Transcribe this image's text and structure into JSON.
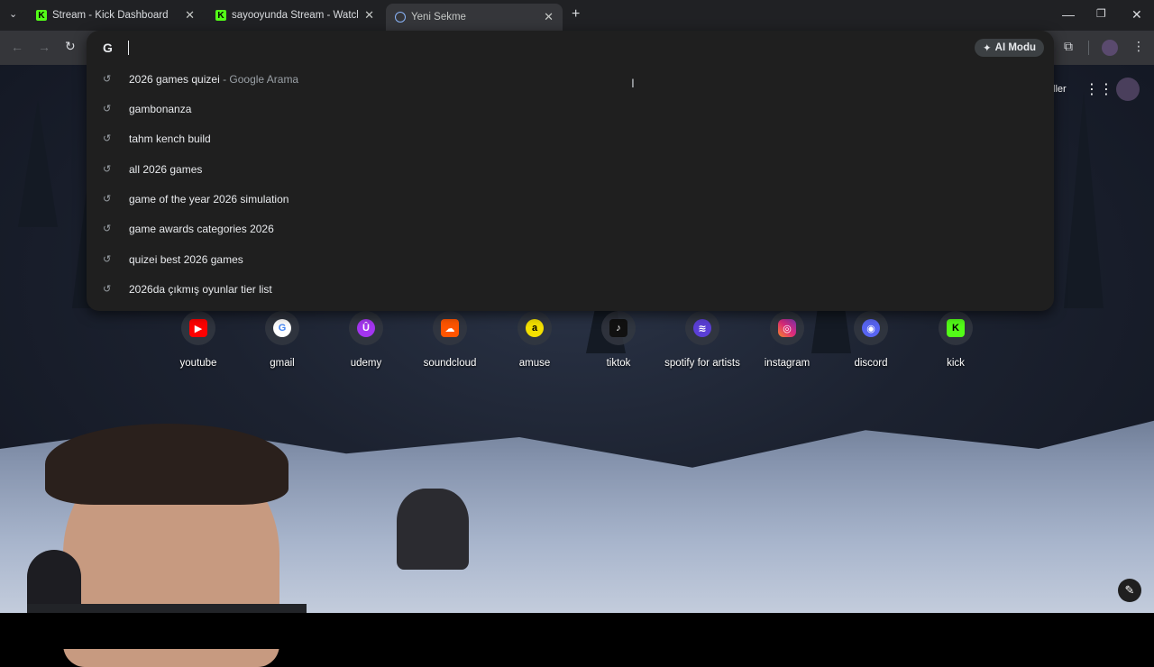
{
  "tabs": [
    {
      "title": "Stream - Kick Dashboard",
      "favicon": "kick-icon"
    },
    {
      "title": "sayooyunda Stream - Watch Liv",
      "favicon": "kick-icon"
    },
    {
      "title": "Yeni Sekme",
      "favicon": "globe-icon"
    }
  ],
  "omnibox": {
    "ai_mode_label": "AI Modu"
  },
  "suggestions": [
    {
      "text": "2026 games quizei",
      "sub": " -  Google Arama"
    },
    {
      "text": "gambonanza",
      "sub": ""
    },
    {
      "text": "tahm kench build",
      "sub": ""
    },
    {
      "text": "all 2026 games",
      "sub": ""
    },
    {
      "text": "game of the year 2026 simulation",
      "sub": ""
    },
    {
      "text": "game awards categories 2026",
      "sub": ""
    },
    {
      "text": "quizei best 2026 games",
      "sub": ""
    },
    {
      "text": "2026da çıkmış oyunlar tier list",
      "sub": ""
    }
  ],
  "top_right": {
    "label_fragment": "ller"
  },
  "shortcuts": [
    {
      "label": "youtube",
      "color": "#ff0000",
      "glyph": "▶"
    },
    {
      "label": "gmail",
      "color": "#4285f4",
      "glyph": "G"
    },
    {
      "label": "udemy",
      "color": "#a435f0",
      "glyph": "Û"
    },
    {
      "label": "soundcloud",
      "color": "#ff5500",
      "glyph": "☁"
    },
    {
      "label": "amuse",
      "color": "#f5e100",
      "glyph": "a"
    },
    {
      "label": "tiktok",
      "color": "#111111",
      "glyph": "♪"
    },
    {
      "label": "spotify for artists",
      "color": "#5b3fd6",
      "glyph": "≋"
    },
    {
      "label": "instagram",
      "color": "#e1306c",
      "glyph": "◎"
    },
    {
      "label": "discord",
      "color": "#5865f2",
      "glyph": "◉"
    },
    {
      "label": "kick",
      "color": "#53fc18",
      "glyph": "K"
    }
  ]
}
